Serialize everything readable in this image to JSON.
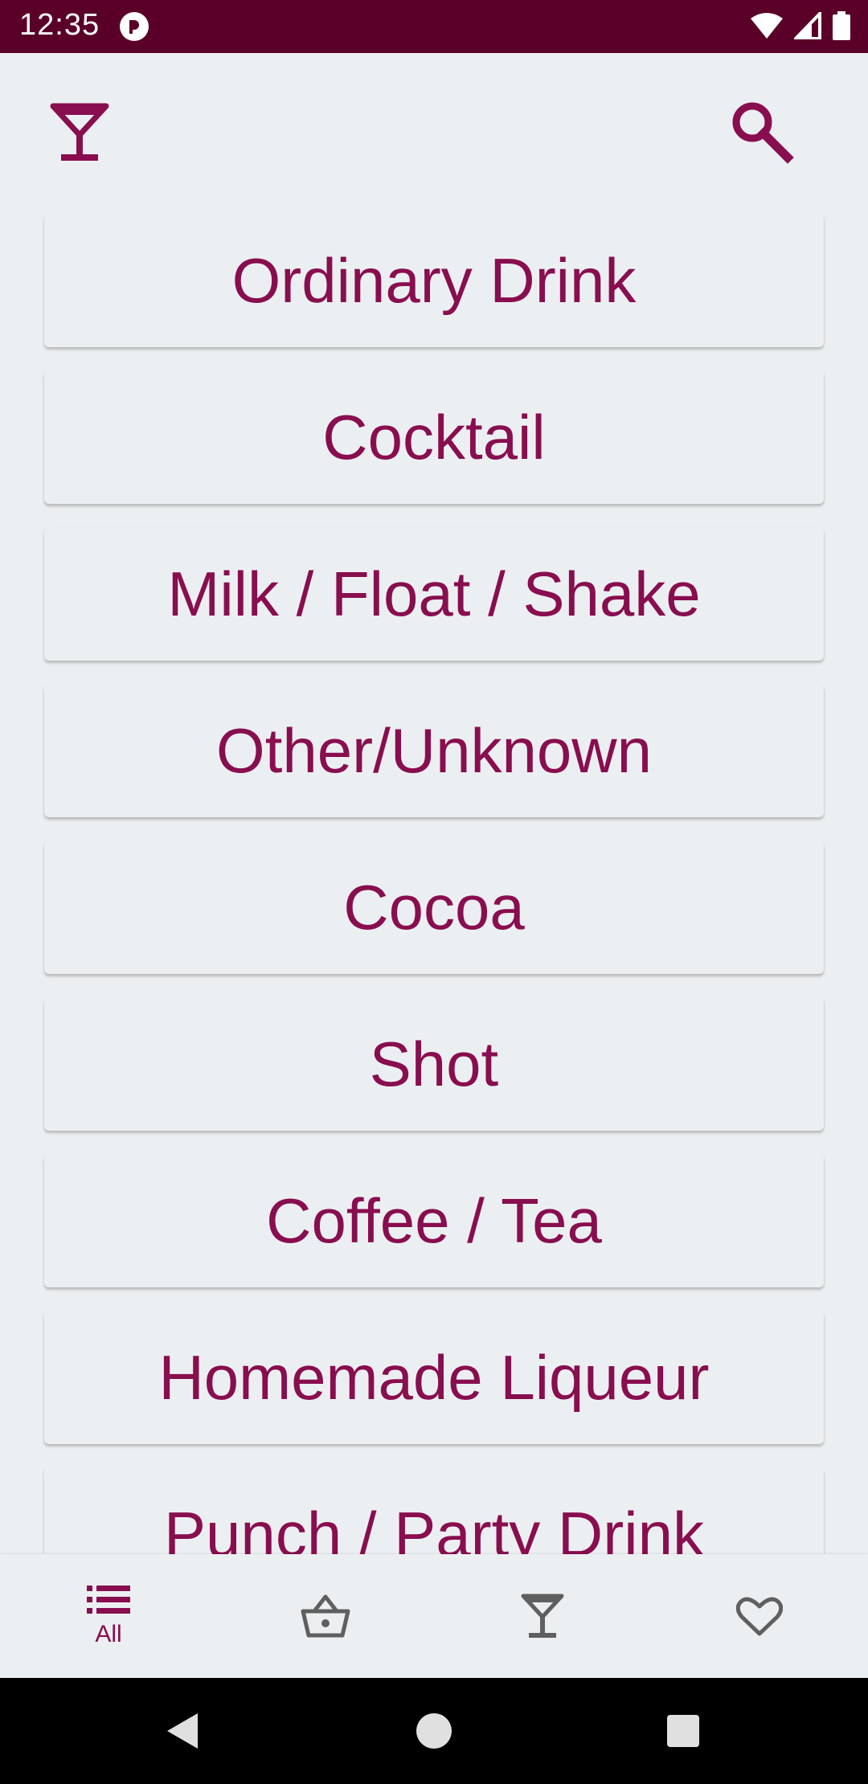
{
  "status_bar": {
    "time": "12:35"
  },
  "categories": [
    {
      "label": "Ordinary Drink"
    },
    {
      "label": "Cocktail"
    },
    {
      "label": "Milk / Float / Shake"
    },
    {
      "label": "Other/Unknown"
    },
    {
      "label": "Cocoa"
    },
    {
      "label": "Shot"
    },
    {
      "label": "Coffee / Tea"
    },
    {
      "label": "Homemade Liqueur"
    },
    {
      "label": "Punch / Party Drink"
    }
  ],
  "bottom_nav": {
    "items": [
      {
        "icon": "list-icon",
        "label": "All",
        "selected": true
      },
      {
        "icon": "basket-icon",
        "label": "",
        "selected": false
      },
      {
        "icon": "cocktail-icon",
        "label": "",
        "selected": false
      },
      {
        "icon": "heart-icon",
        "label": "",
        "selected": false
      }
    ]
  },
  "colors": {
    "accent": "#880e4f",
    "status_bar": "#5a0028",
    "background": "#eceff1",
    "icon_inactive": "#5f5f5f"
  }
}
